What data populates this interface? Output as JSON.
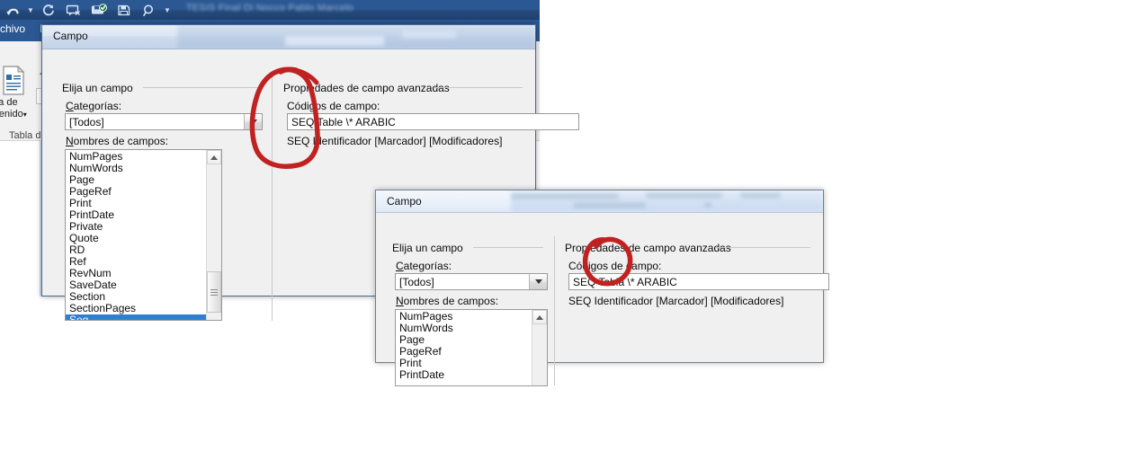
{
  "app": {
    "name": "word-window",
    "document_title": "TESIS Final Di Nocco Pablo Marcelo",
    "tab_archivo": "Archivo",
    "toc_button_line1": "Tabla de",
    "toc_button_line2": "contenido",
    "toc_button_caret": "▾",
    "ribbon_group_label": "Tabla de contenido",
    "quick_access": [
      {
        "name": "undo-icon",
        "label": "Deshacer"
      },
      {
        "name": "undo-dropdown-caret-icon",
        "label": "Deshacer opciones"
      },
      {
        "name": "redo-icon",
        "label": "Rehacer"
      },
      {
        "name": "comment-icon",
        "label": "Comentario"
      },
      {
        "name": "save-check-icon",
        "label": "Guardar y enviar"
      },
      {
        "name": "save-icon",
        "label": "Guardar"
      },
      {
        "name": "find-icon",
        "label": "Buscar"
      },
      {
        "name": "customize-qat-caret-icon",
        "label": "Personalizar"
      }
    ]
  },
  "dialog1": {
    "title": "Campo",
    "left_group_legend": "Elija un campo",
    "categories_label": "Categorías:",
    "categories_label_accel": "C",
    "categories_value": "[Todos]",
    "fieldnames_label": "Nombres de campos:",
    "fieldnames_label_accel": "N",
    "fieldnames": [
      "NumPages",
      "NumWords",
      "Page",
      "PageRef",
      "Print",
      "PrintDate",
      "Private",
      "Quote",
      "RD",
      "Ref",
      "RevNum",
      "SaveDate",
      "Section",
      "SectionPages",
      "Seq"
    ],
    "fieldnames_selected_index": 14,
    "right_group_legend": "Propiedades de campo avanzadas",
    "fieldcodes_label": "Códigos de campo:",
    "fieldcodes_value": "SEQ Table \\* ARABIC",
    "fieldcodes_hint": "SEQ Identificador [Marcador] [Modificadores]",
    "annotation": {
      "name": "red-circle-annotation",
      "color": "#c02222"
    }
  },
  "dialog2": {
    "title": "Campo",
    "left_group_legend": "Elija un campo",
    "categories_label": "Categorías:",
    "categories_label_accel": "C",
    "categories_value": "[Todos]",
    "fieldnames_label": "Nombres de campos:",
    "fieldnames_label_accel": "N",
    "fieldnames": [
      "NumPages",
      "NumWords",
      "Page",
      "PageRef",
      "Print",
      "PrintDate"
    ],
    "right_group_legend": "Propiedades de campo avanzadas",
    "fieldcodes_label": "Códigos de campo:",
    "fieldcodes_value": "SEQ Tabla \\* ARABIC",
    "fieldcodes_hint": "SEQ Identificador [Marcador] [Modificadores]",
    "annotation": {
      "name": "red-circle-annotation",
      "color": "#c02222"
    }
  },
  "colors": {
    "word_titlebar": "#2b5893",
    "dialog_face": "#f0f0f0",
    "selection_blue": "#2f7fd1",
    "annotation_red": "#c02222"
  }
}
